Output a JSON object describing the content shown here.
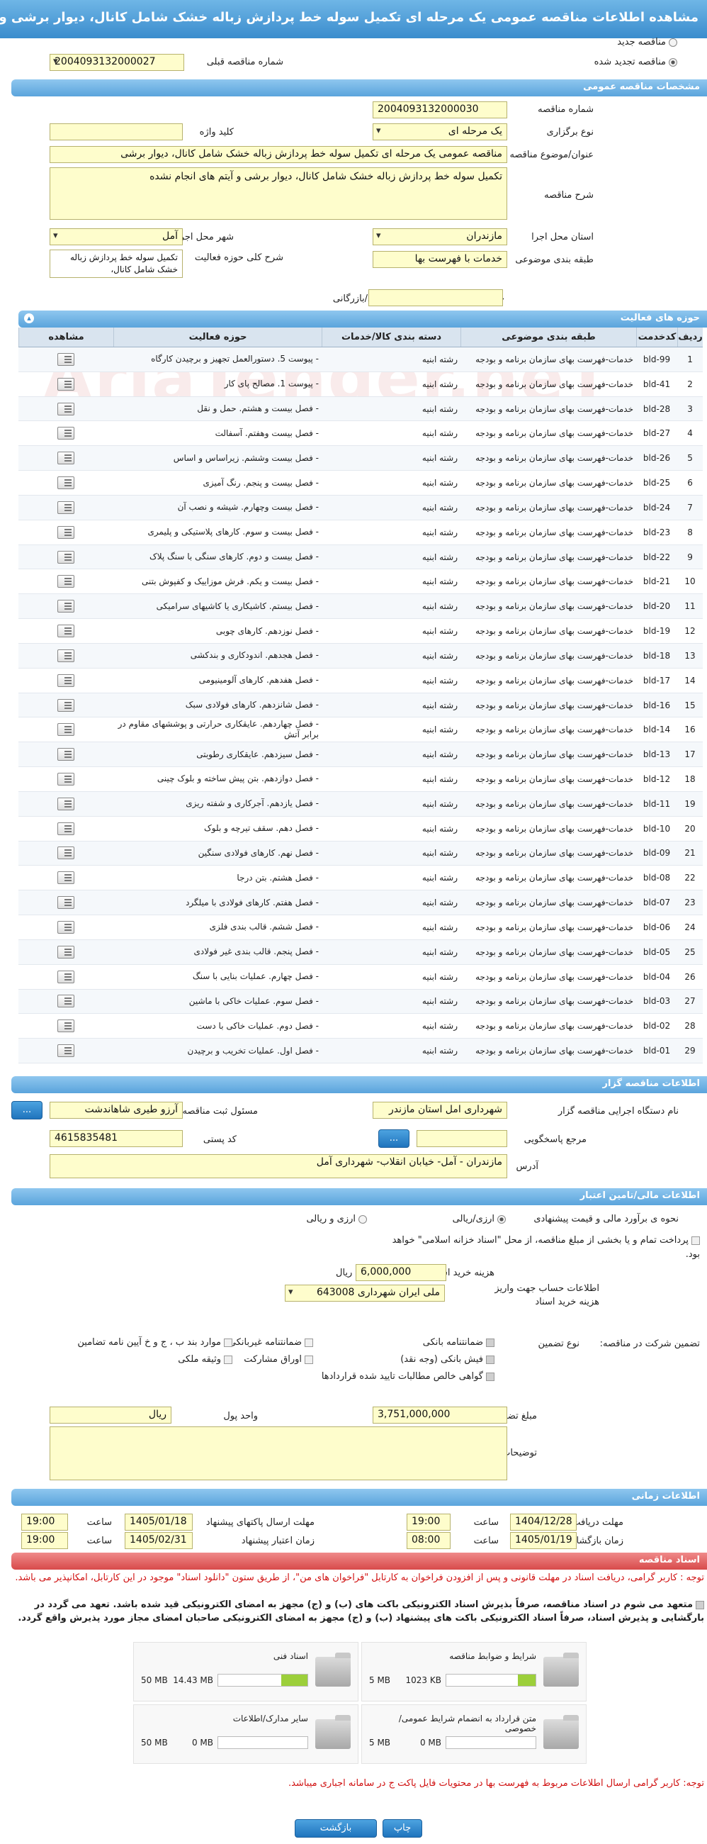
{
  "page": {
    "title": "مشاهده اطلاعات مناقصه عمومی یک مرحله ای تکمیل سوله خط پردازش زباله خشک شامل کانال، دیوار برشی و آیتم های انجام نشده"
  },
  "top": {
    "radio_new": "مناقصه جدید",
    "radio_renewed": "مناقصه تجدید شده",
    "prev_number_label": "شماره مناقصه قبلی",
    "prev_number": "2004093132000027"
  },
  "general": {
    "header": "مشخصات مناقصه عمومی",
    "number_label": "شماره مناقصه",
    "number": "2004093132000030",
    "type_label": "نوع برگزاری",
    "type": "یک مرحله ای",
    "keyword_label": "کلید واژه",
    "keyword": "",
    "subject_label": "عنوان/موضوع مناقصه",
    "subject": "مناقصه عمومی یک مرحله ای تکمیل سوله خط پردازش زباله خشک شامل کانال، دیوار برشی",
    "desc_label": "شرح مناقصه",
    "desc": "تکمیل سوله خط پردازش زباله خشک شامل کانال، دیوار برشی و آیتم های انجام نشده",
    "province_label": "استان محل اجرا",
    "province": "مازندران",
    "city_label": "شهر محل اجرا",
    "city": "آمل",
    "category_label": "طبقه بندی موضوعی",
    "category": "خدمات با فهرست بها",
    "scope_label": "شرح کلی حوزه فعالیت",
    "scope": "تکمیل سوله خط پردازش زباله خشک شامل کانال،",
    "min_score_label": "حداقل امتیاز قابل قبول ارزیابی فنی/بازرگانی",
    "min_score": ""
  },
  "activities": {
    "header": "حوزه های فعالیت",
    "columns": [
      "ردیف",
      "کدخدمت",
      "طبقه بندی موضوعی",
      "دسته بندی کالا/خدمات",
      "حوزه فعالیت",
      "مشاهده"
    ],
    "category_text": "خدمات-فهرست بهای سازمان برنامه و بودجه",
    "group_text": "رشته ابنیه",
    "rows": [
      {
        "idx": "1",
        "code": "bld-99",
        "activity": "- پیوست 5. دستورالعمل تجهیز و برچیدن کارگاه"
      },
      {
        "idx": "2",
        "code": "bld-41",
        "activity": "- پیوست 1. مصالح پای کار"
      },
      {
        "idx": "3",
        "code": "bld-28",
        "activity": "- فصل بیست و هشتم. حمل و نقل"
      },
      {
        "idx": "4",
        "code": "bld-27",
        "activity": "- فصل بیست وهفتم. آسفالت"
      },
      {
        "idx": "5",
        "code": "bld-26",
        "activity": "- فصل بیست وششم. زیراساس و اساس"
      },
      {
        "idx": "6",
        "code": "bld-25",
        "activity": "- فصل بیست و پنجم. رنگ آمیزی"
      },
      {
        "idx": "7",
        "code": "bld-24",
        "activity": "- فصل بیست وچهارم. شیشه و نصب آن"
      },
      {
        "idx": "8",
        "code": "bld-23",
        "activity": "- فصل بیست و سوم. کارهای پلاستیکی و پلیمری"
      },
      {
        "idx": "9",
        "code": "bld-22",
        "activity": "- فصل بیست و دوم. کارهای سنگی با سنگ پلاک"
      },
      {
        "idx": "10",
        "code": "bld-21",
        "activity": "- فصل بیست و یکم. فرش موزاییک و کفپوش بتنی"
      },
      {
        "idx": "11",
        "code": "bld-20",
        "activity": "- فصل بیستم. کاشیکاری یا کاشیهای سرامیکی"
      },
      {
        "idx": "12",
        "code": "bld-19",
        "activity": "- فصل نوزدهم. کارهای چوبی"
      },
      {
        "idx": "13",
        "code": "bld-18",
        "activity": "- فصل هجدهم. اندودکاری و بندکشی"
      },
      {
        "idx": "14",
        "code": "bld-17",
        "activity": "- فصل هفدهم. کارهای آلومینیومی"
      },
      {
        "idx": "15",
        "code": "bld-16",
        "activity": "- فصل شانزدهم. کارهای فولادی سبک"
      },
      {
        "idx": "16",
        "code": "bld-14",
        "activity": "- فصل چهاردهم. عایقکاری حرارتی و پوششهای مقاوم در برابر آتش"
      },
      {
        "idx": "17",
        "code": "bld-13",
        "activity": "- فصل سیزدهم. عایقکاری رطوبتی"
      },
      {
        "idx": "18",
        "code": "bld-12",
        "activity": "- فصل دوازدهم. بتن پیش ساخته و بلوک چینی"
      },
      {
        "idx": "19",
        "code": "bld-11",
        "activity": "- فصل یازدهم. آجرکاری و شفته ریزی"
      },
      {
        "idx": "20",
        "code": "bld-10",
        "activity": "- فصل دهم. سقف تیرچه و بلوک"
      },
      {
        "idx": "21",
        "code": "bld-09",
        "activity": "- فصل نهم. کارهای فولادی سنگین"
      },
      {
        "idx": "22",
        "code": "bld-08",
        "activity": "- فصل هشتم. بتن درجا"
      },
      {
        "idx": "23",
        "code": "bld-07",
        "activity": "- فصل هفتم. کارهای فولادی با میلگرد"
      },
      {
        "idx": "24",
        "code": "bld-06",
        "activity": "- فصل ششم. قالب بندی فلزی"
      },
      {
        "idx": "25",
        "code": "bld-05",
        "activity": "- فصل پنجم. قالب بندی غیر فولادی"
      },
      {
        "idx": "26",
        "code": "bld-04",
        "activity": "- فصل چهارم. عملیات بنایی با سنگ"
      },
      {
        "idx": "27",
        "code": "bld-03",
        "activity": "- فصل سوم. عملیات خاکی با ماشین"
      },
      {
        "idx": "28",
        "code": "bld-02",
        "activity": "- فصل دوم. عملیات خاکی با دست"
      },
      {
        "idx": "29",
        "code": "bld-01",
        "activity": "- فصل اول. عملیات تخریب و برچیدن"
      }
    ]
  },
  "organizer": {
    "header": "اطلاعات مناقصه گزار",
    "org_label": "نام دستگاه اجرایی مناقصه گزار",
    "org": "شهرداری امل استان مازندر",
    "officer_label": "مسئول ثبت مناقصه",
    "officer": "آرزو طیری شاهاندشت",
    "ref_label": "مرجع پاسخگویی",
    "ref": "",
    "postal_label": "کد پستی",
    "postal": "4615835481",
    "address_label": "آدرس",
    "address": "مازندران - آمل- خیابان انقلاب- شهرداری آمل",
    "more_btn": "..."
  },
  "finance": {
    "header": "اطلاعات مالی/تامین اعتبار",
    "estimate_label": "نحوه ی برآورد مالی و قیمت پیشنهادی",
    "opt_rial": "ارزی/ریالی",
    "opt_currency": "ارزی و ریالی",
    "treasury_text": "پرداخت تمام و یا بخشی از مبلغ مناقصه، از محل \"اسناد خزانه اسلامی\" خواهد بود.",
    "doc_fee_label": "هزینه خرید اسناد",
    "doc_fee": "6,000,000",
    "doc_fee_unit": "ریال",
    "account_label": "اطلاعات حساب جهت واریز هزینه خرید اسناد",
    "account": "ملی ایران شهرداری 643008",
    "guarantee_type_label": "نوع تضمین",
    "participation_label": "تضمین شرکت در مناقصه:",
    "guarantees": [
      {
        "label": "ضمانتنامه بانکی",
        "checked": true
      },
      {
        "label": "ضمانتنامه غیربانکی",
        "checked": false
      },
      {
        "label": "موارد بند ب ، ج و خ آیین نامه تضامین",
        "checked": false
      },
      {
        "label": "فیش بانکی (وجه نقد)",
        "checked": true
      },
      {
        "label": "اوراق مشارکت",
        "checked": false
      },
      {
        "label": "وثیقه ملکی",
        "checked": false
      },
      {
        "label": "گواهی خالص مطالبات تایید شده قراردادها",
        "checked": true
      }
    ],
    "amount_label": "مبلغ تضمین",
    "amount": "3,751,000,000",
    "unit_label": "واحد پول",
    "unit": "ریال",
    "notes_label": "توضیحات",
    "notes": ""
  },
  "timing": {
    "header": "اطلاعات زمانی",
    "receive_label": "مهلت دریافت اسناد",
    "receive_date": "1404/12/28",
    "receive_time": "19:00",
    "send_label": "مهلت ارسال پاکتهای پیشنهاد",
    "send_date": "1405/01/18",
    "send_time": "19:00",
    "open_label": "زمان بازگشایی پاکت ها",
    "open_date": "1405/01/19",
    "open_time": "08:00",
    "validity_label": "زمان اعتبار پیشنهاد",
    "validity_date": "1405/02/31",
    "validity_time": "19:00",
    "time_label": "ساعت"
  },
  "documents": {
    "header": "اسناد مناقصه",
    "notice1": "توجه : کاربر گرامی، دریافت اسناد در مهلت قانونی و پس از افزودن فراخوان به کارتابل \"فراخوان های من\"، از طریق ستون \"دانلود اسناد\" موجود در این کارتابل، امکانپذیر می باشد.",
    "notice2": "متعهد می شوم در اسناد مناقصه، صرفاً بذیرش اسناد الکترونیکی باکت های (ب) و (ج) مجهز به امضای الکترونیکی قید شده باشد. تعهد می گردد در بارگشایی و پذیرش اسناد، صرفاً اسناد الکترونیکی باکت های پیشنهاد (ب) و (ج) مجهز به امضای الکترونیکی صاحبان امضای مجاز مورد پذیرش واقع گردد.",
    "cards": [
      {
        "title": "شرایط و ضوابط مناقصه",
        "used": "1023 KB",
        "max": "5 MB",
        "fill": 0.2
      },
      {
        "title": "اسناد فنی",
        "used": "14.43 MB",
        "max": "50 MB",
        "fill": 0.29
      },
      {
        "title": "متن قرارداد به انضمام شرایط عمومی/خصوصی",
        "used": "0 MB",
        "max": "5 MB",
        "fill": 0
      },
      {
        "title": "سایر مدارک/اطلاعات",
        "used": "0 MB",
        "max": "50 MB",
        "fill": 0
      }
    ],
    "notice3": "توجه: کاربر گرامی ارسال اطلاعات مربوط به فهرست بها در محتویات فایل پاکت ج در سامانه اجباری میباشد."
  },
  "footer": {
    "print_btn": "چاپ",
    "back_btn": "بازگشت"
  },
  "watermark": "AriaTender.neT"
}
